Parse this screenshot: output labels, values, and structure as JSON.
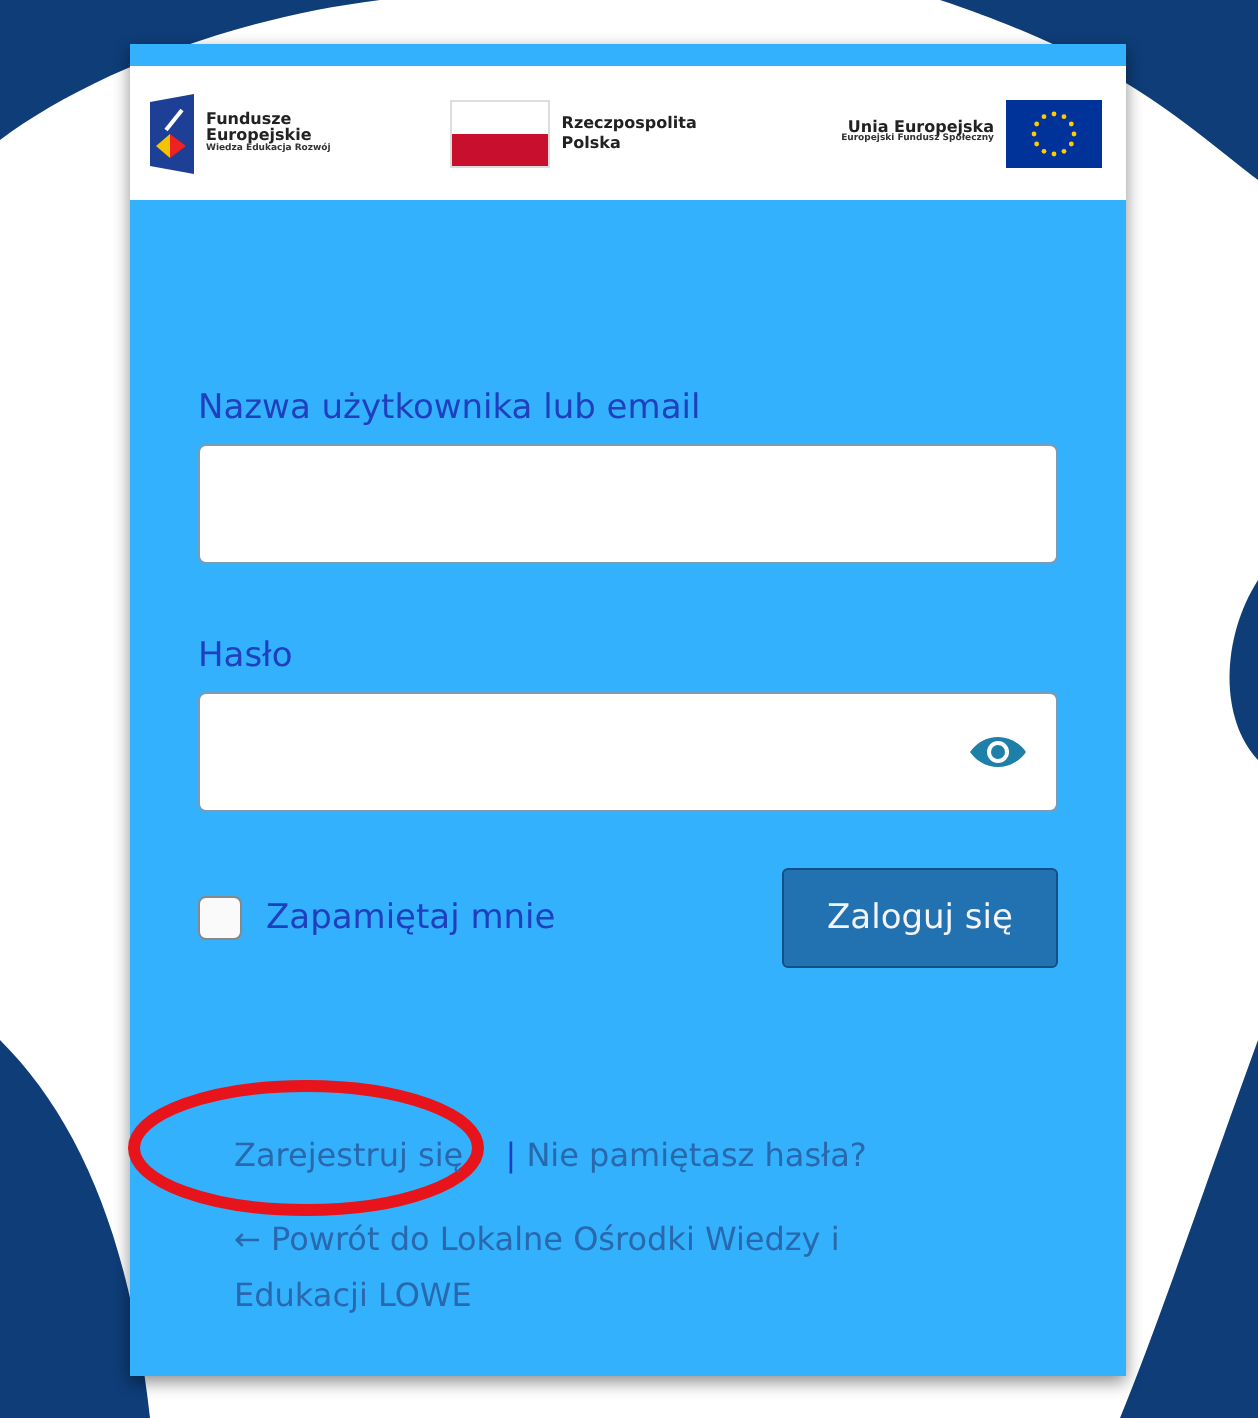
{
  "logos": {
    "funds": {
      "title": "Fundusze Europejskie",
      "subtitle": "Wiedza Edukacja Rozwój"
    },
    "country": {
      "title": "Rzeczpospolita Polska"
    },
    "union": {
      "title": "Unia Europejska",
      "subtitle": "Europejski Fundusz Społeczny"
    }
  },
  "form": {
    "username_label": "Nazwa użytkownika lub email",
    "password_label": "Hasło",
    "remember": {
      "label": "Zapamiętaj mnie",
      "checked": false
    },
    "submit": "Zaloguj się"
  },
  "links": {
    "register": "Zarejestruj się",
    "separator": "|",
    "lost_password": "Nie pamiętasz hasła?",
    "back": "← Powrót do Lokalne Ośrodki Wiedzy i Edukacji LOWE"
  },
  "annotation": {
    "kind": "ellipse"
  }
}
